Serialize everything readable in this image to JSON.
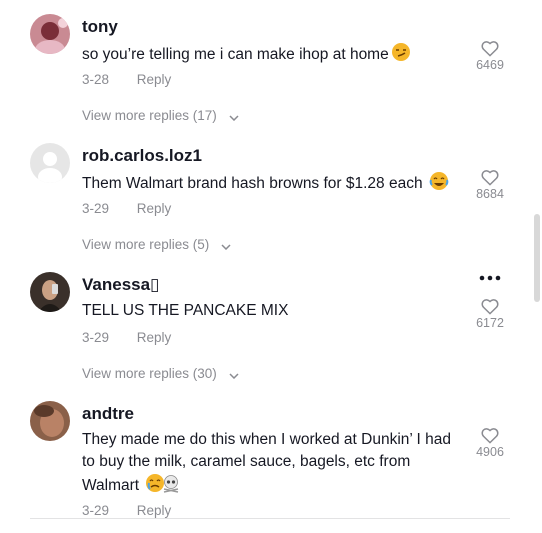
{
  "comments": [
    {
      "username": "tony",
      "text": "so you’re telling me i can make ihop at home",
      "emoji": "smirk-emoji",
      "date": "3-28",
      "reply_label": "Reply",
      "likes": "6469",
      "view_more": "View more replies (17)"
    },
    {
      "username": "rob.carlos.loz1",
      "text": "Them Walmart brand hash browns for $1.28 each",
      "emoji": "tears-of-joy-emoji",
      "date": "3-29",
      "reply_label": "Reply",
      "likes": "8684",
      "view_more": "View more replies (5)"
    },
    {
      "username": "Vanessa▯",
      "text": "TELL US THE PANCAKE MIX",
      "date": "3-29",
      "reply_label": "Reply",
      "likes": "6172",
      "view_more": "View more replies (30)"
    },
    {
      "username": "andtre",
      "text": "They made me do this when I worked at Dunkin’ I had to buy the milk, caramel sauce, bagels, etc from Walmart",
      "emoji": "crying-skull-emoji",
      "date": "3-29",
      "reply_label": "Reply",
      "likes": "4906"
    }
  ],
  "colors": {
    "text": "#161823",
    "secondary": "#8a8b91",
    "divider": "#e3e3e4"
  },
  "icons": [
    "heart-outline-icon",
    "chevron-down-icon",
    "more-dots-icon"
  ]
}
